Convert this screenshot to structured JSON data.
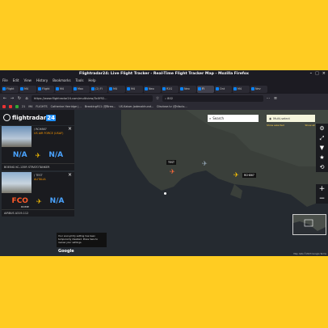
{
  "window": {
    "title": "Flightradar24: Live Flight Tracker - Real-Time Flight Tracker Map - Mozilla Firefox",
    "controls": [
      "–",
      "□",
      "×"
    ]
  },
  "menu": [
    "File",
    "Edit",
    "View",
    "History",
    "Bookmarks",
    "Tools",
    "Help"
  ],
  "tabs": [
    {
      "label": "Flight"
    },
    {
      "label": "M4"
    },
    {
      "label": "Flight"
    },
    {
      "label": "M4"
    },
    {
      "label": "Max"
    },
    {
      "label": "(2) Fl"
    },
    {
      "label": "M4"
    },
    {
      "label": "M4"
    },
    {
      "label": "Neo"
    },
    {
      "label": "R2G"
    },
    {
      "label": "Neo"
    },
    {
      "label": "Fl",
      "active": true
    },
    {
      "label": "Ont"
    },
    {
      "label": "M4"
    },
    {
      "label": "Nev"
    }
  ],
  "nav": {
    "url": "https://www.flightradar24.com/multiview/3c0f92…",
    "search": "802"
  },
  "bookmarks": [
    "21",
    "M4",
    "FLIGHTS",
    "Catherine Herridge (…",
    "Breaking911 (@Brea…",
    "US-Kaiser-Jodenakhund…",
    "Disclose.tv (@disclo…"
  ],
  "app": {
    "logo": "flightradar",
    "logo_num": "24",
    "search_label": "Search",
    "multiselect_label": "Multi-select",
    "show_selected": "Show selected",
    "show_all": "Show all"
  },
  "cards": [
    {
      "reg": "/ RCH867",
      "airline": "US AIR FORCE (USAF)",
      "from": "N/A",
      "to": "N/A",
      "aircraft": "BOEING KC-135R STRATOTANKER"
    },
    {
      "reg": "/ TEST",
      "airline": "ALITALIA",
      "from": "FCO",
      "from_city": "ROME",
      "to": "N/A",
      "aircraft": "AIRBUS A319-112"
    }
  ],
  "map": {
    "label_test": "TEST",
    "label_rch": "RCH867",
    "notice": "Your anonymity setting has been temporarily disabled. Press here to review your settings.",
    "google": "Google",
    "attribution": "Map data ©2023 Google  Terms"
  },
  "colors": {
    "accent": "#4aa3ff",
    "plane": "#ffc400",
    "airline": "#ff9a00",
    "bg": "#ffcc22"
  }
}
